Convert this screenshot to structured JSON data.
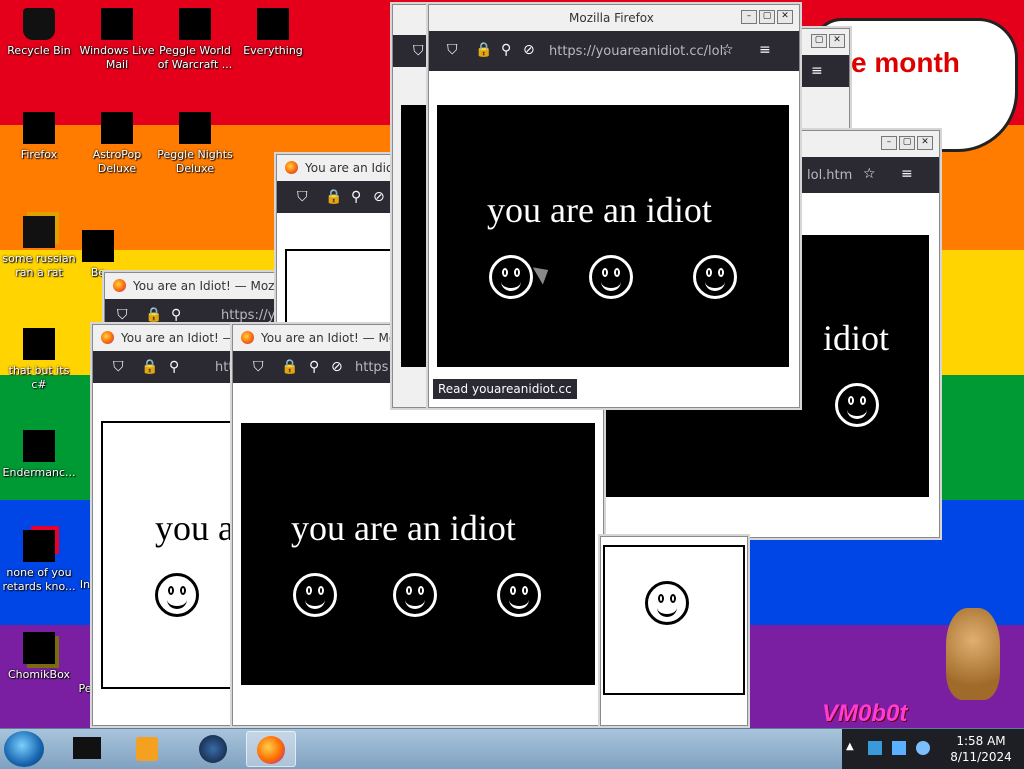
{
  "desktop": {
    "rainbow": [
      "#e4001a",
      "#ff7c00",
      "#ffd400",
      "#009a35",
      "#0046e6",
      "#7a1fa2"
    ],
    "icons": [
      {
        "label": "Recycle Bin",
        "icon": "recycle-bin-icon"
      },
      {
        "label": "Windows Live Mail",
        "icon": "mail-icon"
      },
      {
        "label": "Peggle World of Warcraft ...",
        "icon": "peggle-icon"
      },
      {
        "label": "Everything",
        "icon": "search-icon"
      },
      {
        "label": "Firefox",
        "icon": "firefox-icon"
      },
      {
        "label": "AstroPop Deluxe",
        "icon": "astropop-icon"
      },
      {
        "label": "Peggle Nights Deluxe",
        "icon": "peggle-nights-icon"
      },
      {
        "label": "some russian ran a rat",
        "icon": "app-icon"
      },
      {
        "label": "Be",
        "icon": "gem-icon"
      },
      {
        "label": "that but its c#",
        "icon": "shortcut-icon"
      },
      {
        "label": "Endermanc...",
        "icon": "terminal-icon"
      },
      {
        "label": "none of you retards kno...",
        "icon": "opera-icon"
      },
      {
        "label": "In",
        "icon": "app-icon"
      },
      {
        "label": "ChomikBox",
        "icon": "chomikbox-icon"
      },
      {
        "label": "Pe",
        "icon": "app-icon"
      }
    ],
    "bubble_text": "e month",
    "watermark": "VM0b0t"
  },
  "windows": {
    "w1_title": "You are an Idiot! — Mozilla",
    "w2_title": "You are an Idiot! — M",
    "w3_title": "You are an Idiot! — Mozi",
    "w4_title": "You are an Idiot",
    "w5_title": "Mozilla Firefox",
    "url_short": "https://y",
    "url_short2": "https:",
    "url_short3": "htt",
    "url_main": "https://youareanidiot.cc/lol.",
    "url_right": "lol.htm",
    "phrase": "you are an idiot",
    "phrase_partial": "you a",
    "phrase_right": "idiot",
    "status": "Read youareanidiot.cc"
  },
  "taskbar": {
    "time": "1:58 AM",
    "date": "8/11/2024"
  }
}
